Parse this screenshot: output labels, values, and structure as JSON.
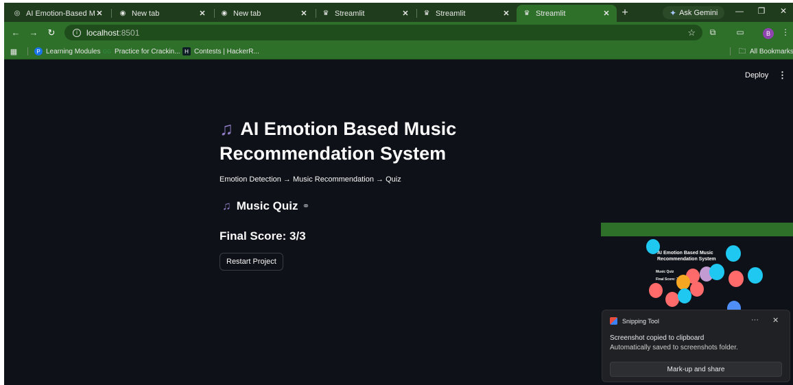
{
  "browser": {
    "tabs": [
      {
        "title": "AI Emotion-Based Musi",
        "icon": "chrome-circle-icon"
      },
      {
        "title": "New tab",
        "icon": "chrome-icon"
      },
      {
        "title": "New tab",
        "icon": "chrome-icon"
      },
      {
        "title": "Streamlit",
        "icon": "streamlit-crown-icon"
      },
      {
        "title": "Streamlit",
        "icon": "streamlit-crown-icon"
      },
      {
        "title": "Streamlit",
        "icon": "streamlit-crown-icon",
        "active": true
      }
    ],
    "new_tab_symbol": "+",
    "gemini_label": "Ask Gemini",
    "address": {
      "host": "localhost",
      "port": ":8501"
    },
    "profile_initial": "B",
    "bookmarks": [
      {
        "label": "Learning Modules",
        "icon": "p-icon"
      },
      {
        "label": "Practice for Crackin...",
        "icon": "gfg-icon"
      },
      {
        "label": "Contests | HackerR...",
        "icon": "hackerrank-icon"
      }
    ],
    "all_bookmarks_label": "All Bookmarks"
  },
  "app": {
    "deploy_label": "Deploy",
    "title": "AI Emotion Based Music Recommendation System",
    "subtitle": "Emotion Detection → Music Recommendation → Quiz",
    "quiz_heading": "Music Quiz",
    "score_text": "Final Score: 3/3",
    "restart_label": "Restart Project"
  },
  "preview": {
    "title": "AI Emotion Based Music Recommendation System",
    "quiz": "Music Quiz",
    "score": "Final Score: 3"
  },
  "toast": {
    "app_name": "Snipping Tool",
    "message": "Screenshot copied to clipboard",
    "detail": "Automatically saved to screenshots folder.",
    "button_label": "Mark-up and share"
  },
  "colors": {
    "tab_strip": "#1f3d1c",
    "toolbar": "#2e6f2a",
    "page_bg": "#0e1117",
    "accent_note": "#8e7cc3"
  }
}
